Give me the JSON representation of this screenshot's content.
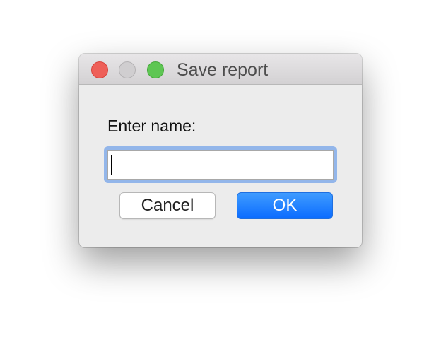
{
  "window": {
    "title": "Save report"
  },
  "dialog": {
    "prompt_label": "Enter name:",
    "name_input": {
      "value": "",
      "placeholder": ""
    },
    "cancel_label": "Cancel",
    "ok_label": "OK"
  },
  "colors": {
    "close_button": "#ee5f58",
    "minimize_button": "#d0ced0",
    "zoom_button": "#5ec653",
    "ok_button": "#1478ff",
    "focus_ring": "#93b6ea",
    "dialog_background": "#ececec"
  }
}
